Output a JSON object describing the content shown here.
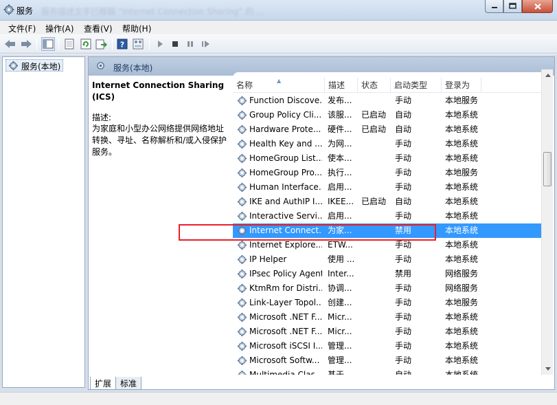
{
  "window": {
    "title": "服务",
    "blurred_title": "服务描述文字已模糊 “Internet Connection Sharing” 的 ..."
  },
  "menu": [
    "文件(F)",
    "操作(A)",
    "查看(V)",
    "帮助(H)"
  ],
  "tree": {
    "root_label": "服务(本地)"
  },
  "pane_header": "服务(本地)",
  "detail": {
    "service_name": "Internet Connection Sharing (ICS)",
    "desc_label": "描述:",
    "desc_text": "为家庭和小型办公网络提供网络地址转换、寻址、名称解析和/或入侵保护服务。"
  },
  "columns": [
    "名称",
    "描述",
    "状态",
    "启动类型",
    "登录为"
  ],
  "rows": [
    {
      "name": "Function Discove...",
      "desc": "发布...",
      "status": "",
      "start": "手动",
      "logon": "本地服务"
    },
    {
      "name": "Group Policy Cli...",
      "desc": "该服...",
      "status": "已启动",
      "start": "自动",
      "logon": "本地系统"
    },
    {
      "name": "Hardware Prote...",
      "desc": "硬件...",
      "status": "已启动",
      "start": "自动",
      "logon": "本地系统"
    },
    {
      "name": "Health Key and ...",
      "desc": "为网...",
      "status": "",
      "start": "手动",
      "logon": "本地系统"
    },
    {
      "name": "HomeGroup List...",
      "desc": "使本...",
      "status": "",
      "start": "手动",
      "logon": "本地系统"
    },
    {
      "name": "HomeGroup Pro...",
      "desc": "执行...",
      "status": "",
      "start": "手动",
      "logon": "本地服务"
    },
    {
      "name": "Human Interface...",
      "desc": "启用...",
      "status": "",
      "start": "手动",
      "logon": "本地系统"
    },
    {
      "name": "IKE and AuthIP I...",
      "desc": "IKEE...",
      "status": "已启动",
      "start": "自动",
      "logon": "本地系统"
    },
    {
      "name": "Interactive Servi...",
      "desc": "启用...",
      "status": "",
      "start": "手动",
      "logon": "本地系统"
    },
    {
      "name": "Internet Connect...",
      "desc": "为家...",
      "status": "",
      "start": "禁用",
      "logon": "本地系统"
    },
    {
      "name": "Internet Explore...",
      "desc": "ETW...",
      "status": "",
      "start": "手动",
      "logon": "本地系统"
    },
    {
      "name": "IP Helper",
      "desc": "使用 ...",
      "status": "",
      "start": "手动",
      "logon": "本地系统"
    },
    {
      "name": "IPsec Policy Agent",
      "desc": "Inter...",
      "status": "",
      "start": "禁用",
      "logon": "网络服务"
    },
    {
      "name": "KtmRm for Distri...",
      "desc": "协调...",
      "status": "",
      "start": "手动",
      "logon": "网络服务"
    },
    {
      "name": "Link-Layer Topol...",
      "desc": "创建...",
      "status": "",
      "start": "手动",
      "logon": "本地服务"
    },
    {
      "name": "Microsoft .NET F...",
      "desc": "Micr...",
      "status": "",
      "start": "手动",
      "logon": "本地系统"
    },
    {
      "name": "Microsoft .NET F...",
      "desc": "Micr...",
      "status": "",
      "start": "手动",
      "logon": "本地系统"
    },
    {
      "name": "Microsoft iSCSI I...",
      "desc": "管理...",
      "status": "",
      "start": "手动",
      "logon": "本地系统"
    },
    {
      "name": "Microsoft Softw...",
      "desc": "管理...",
      "status": "",
      "start": "手动",
      "logon": "本地系统"
    },
    {
      "name": "Multimedia Clas...",
      "desc": "基于...",
      "status": "",
      "start": "自动",
      "logon": "本地系统"
    }
  ],
  "selected_row": 9,
  "tabs": [
    "扩展",
    "标准"
  ],
  "colors": {
    "selection": "#3399ff",
    "highlight_box": "#e81f2a"
  },
  "icons": {
    "app": "services-gear-icon",
    "toolbar": [
      "back-arrow-icon",
      "forward-arrow-icon",
      "show-hide-console-tree-icon",
      "properties-icon",
      "refresh-icon",
      "export-list-icon",
      "help-icon",
      "view-icon",
      "start-service-icon",
      "stop-service-icon",
      "pause-service-icon",
      "restart-service-icon"
    ]
  }
}
